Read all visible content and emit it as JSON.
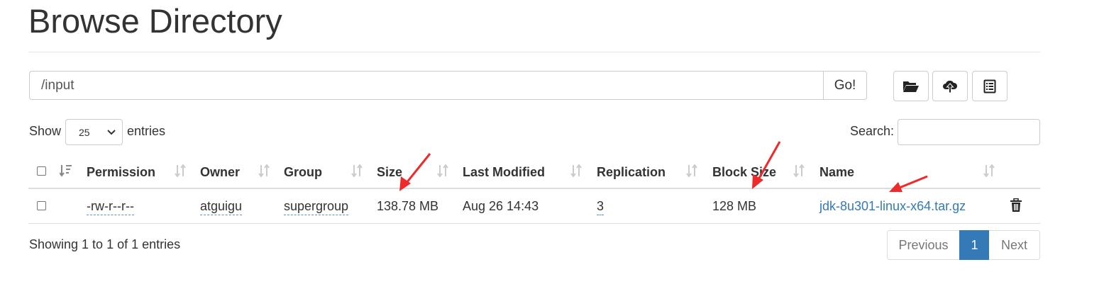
{
  "page": {
    "title": "Browse Directory"
  },
  "path_bar": {
    "value": "/input",
    "go_label": "Go!"
  },
  "toolbar": {
    "icons": [
      "folder-open-icon",
      "cloud-upload-icon",
      "list-alt-icon"
    ]
  },
  "table_controls": {
    "show_label": "Show",
    "page_length": "25",
    "entries_label": "entries",
    "search_label": "Search:",
    "search_value": ""
  },
  "table": {
    "columns": [
      "Permission",
      "Owner",
      "Group",
      "Size",
      "Last Modified",
      "Replication",
      "Block Size",
      "Name"
    ],
    "rows": [
      {
        "permission": "-rw-r--r--",
        "owner": "atguigu",
        "group": "supergroup",
        "size": "138.78 MB",
        "last_modified": "Aug 26 14:43",
        "replication": "3",
        "block_size": "128 MB",
        "name": "jdk-8u301-linux-x64.tar.gz"
      }
    ]
  },
  "footer": {
    "info": "Showing 1 to 1 of 1 entries",
    "previous_label": "Previous",
    "current_page": "1",
    "next_label": "Next"
  },
  "colors": {
    "link": "#337ab7",
    "annotation_arrow": "#ee2a2a"
  }
}
